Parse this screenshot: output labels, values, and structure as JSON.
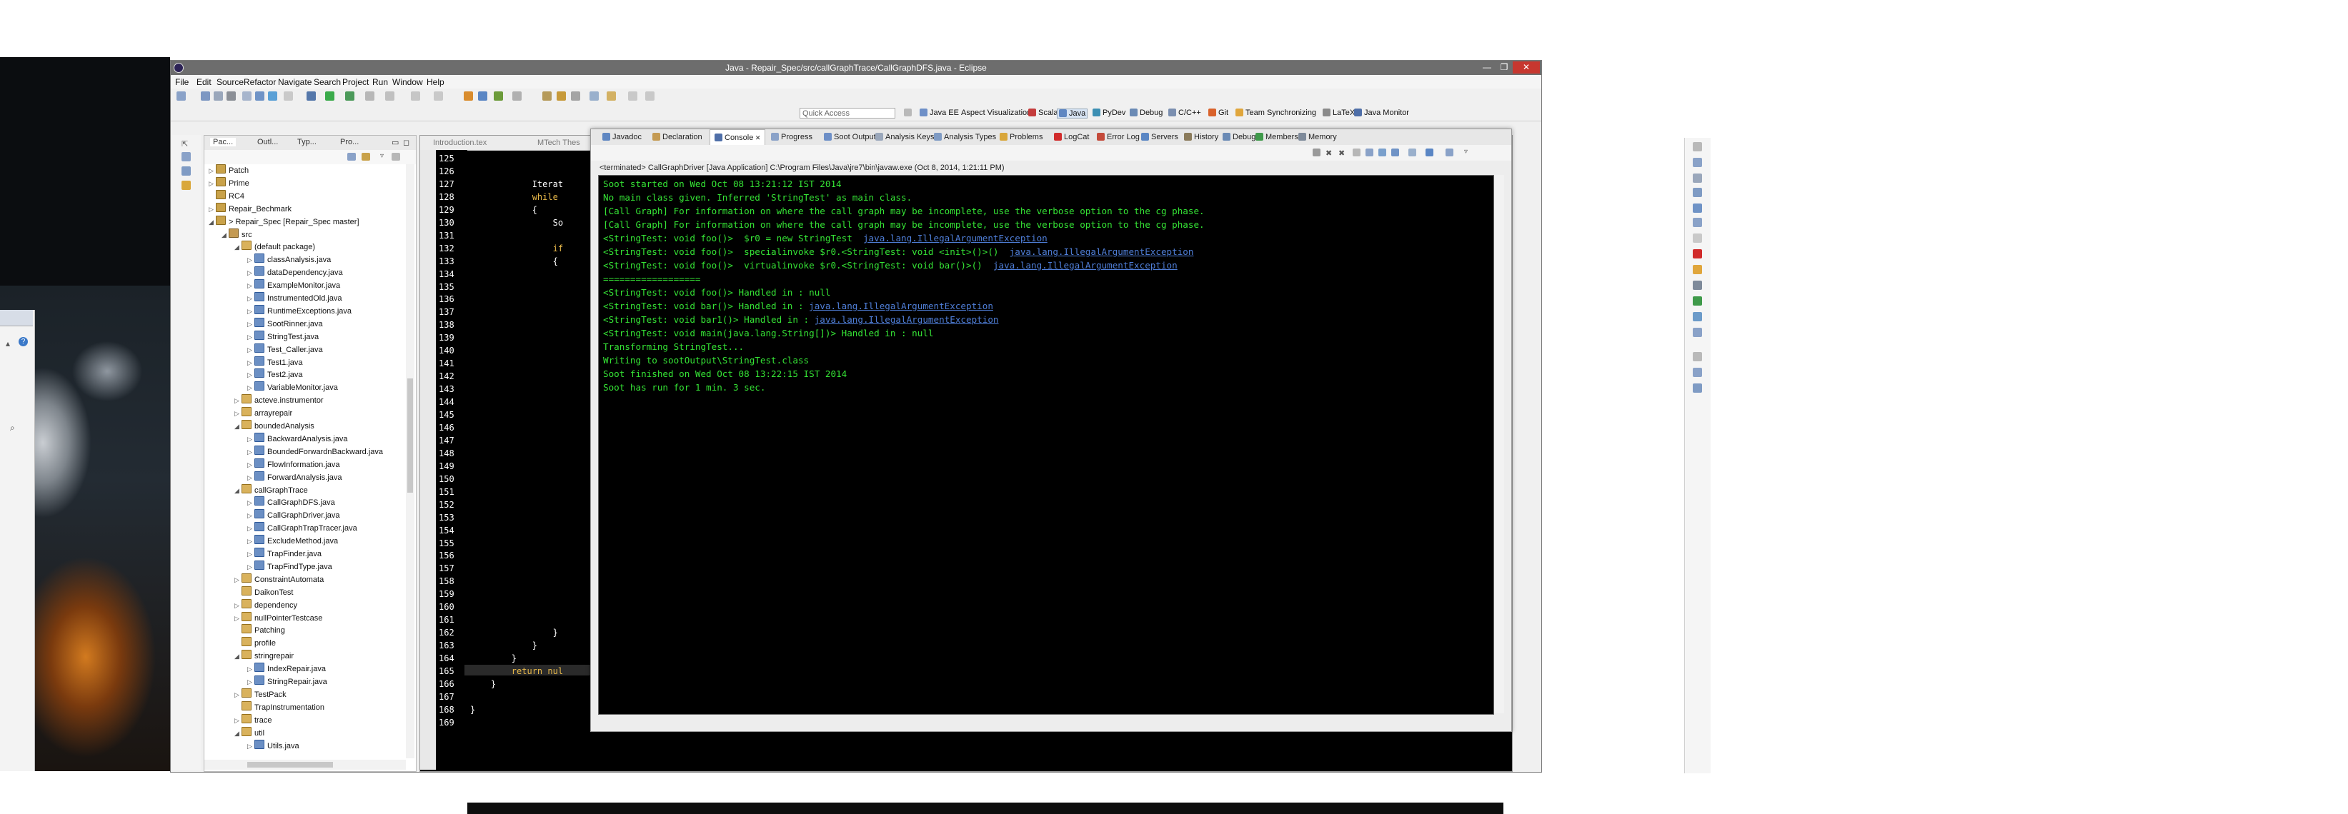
{
  "window": {
    "title": "Java - Repair_Spec/src/callGraphTrace/CallGraphDFS.java - Eclipse",
    "min": "—",
    "max": "❐",
    "close": "✕"
  },
  "menu": [
    "File",
    "Edit",
    "Source",
    "Refactor",
    "Navigate",
    "Search",
    "Project",
    "Run",
    "Window",
    "Help"
  ],
  "quick_access": {
    "placeholder": "Quick Access"
  },
  "perspectives": [
    "Java EE",
    "Aspect Visualization",
    "Scala",
    "Java",
    "PyDev",
    "Debug",
    "C/C++",
    "Git",
    "Team Synchronizing",
    "LaTeX",
    "Java Monitor"
  ],
  "package_explorer": {
    "tabs": [
      "Pac...",
      "Outl...",
      "Typ...",
      "Pro..."
    ],
    "tree": [
      {
        "label": "Patch",
        "depth": 0,
        "type": "proj",
        "tw": "▷"
      },
      {
        "label": "Prime",
        "depth": 0,
        "type": "proj",
        "tw": "▷"
      },
      {
        "label": "RC4",
        "depth": 0,
        "type": "proj",
        "tw": ""
      },
      {
        "label": "Repair_Bechmark",
        "depth": 0,
        "type": "proj",
        "tw": "▷"
      },
      {
        "label": "> Repair_Spec [Repair_Spec master]",
        "depth": 0,
        "type": "proj",
        "tw": "◢"
      },
      {
        "label": "src",
        "depth": 1,
        "type": "src",
        "tw": "◢"
      },
      {
        "label": "(default package)",
        "depth": 2,
        "type": "pkg",
        "tw": "◢"
      },
      {
        "label": "classAnalysis.java",
        "depth": 3,
        "type": "java",
        "tw": "▷"
      },
      {
        "label": "dataDependency.java",
        "depth": 3,
        "type": "java",
        "tw": "▷"
      },
      {
        "label": "ExampleMonitor.java",
        "depth": 3,
        "type": "java",
        "tw": "▷"
      },
      {
        "label": "InstrumentedOld.java",
        "depth": 3,
        "type": "java",
        "tw": "▷"
      },
      {
        "label": "RuntimeExceptions.java",
        "depth": 3,
        "type": "java",
        "tw": "▷"
      },
      {
        "label": "SootRinner.java",
        "depth": 3,
        "type": "java",
        "tw": "▷"
      },
      {
        "label": "StringTest.java",
        "depth": 3,
        "type": "java",
        "tw": "▷"
      },
      {
        "label": "Test_Caller.java",
        "depth": 3,
        "type": "java",
        "tw": "▷"
      },
      {
        "label": "Test1.java",
        "depth": 3,
        "type": "java",
        "tw": "▷"
      },
      {
        "label": "Test2.java",
        "depth": 3,
        "type": "java",
        "tw": "▷"
      },
      {
        "label": "VariableMonitor.java",
        "depth": 3,
        "type": "java",
        "tw": "▷"
      },
      {
        "label": "acteve.instrumentor",
        "depth": 2,
        "type": "pkg",
        "tw": "▷"
      },
      {
        "label": "arrayrepair",
        "depth": 2,
        "type": "pkg",
        "tw": "▷"
      },
      {
        "label": "boundedAnalysis",
        "depth": 2,
        "type": "pkg",
        "tw": "◢"
      },
      {
        "label": "BackwardAnalysis.java",
        "depth": 3,
        "type": "java",
        "tw": "▷"
      },
      {
        "label": "BoundedForwardnBackward.java",
        "depth": 3,
        "type": "java",
        "tw": "▷"
      },
      {
        "label": "FlowInformation.java",
        "depth": 3,
        "type": "java",
        "tw": "▷"
      },
      {
        "label": "ForwardAnalysis.java",
        "depth": 3,
        "type": "java",
        "tw": "▷"
      },
      {
        "label": "callGraphTrace",
        "depth": 2,
        "type": "pkg",
        "tw": "◢"
      },
      {
        "label": "CallGraphDFS.java",
        "depth": 3,
        "type": "java",
        "tw": "▷"
      },
      {
        "label": "CallGraphDriver.java",
        "depth": 3,
        "type": "java",
        "tw": "▷"
      },
      {
        "label": "CallGraphTrapTracer.java",
        "depth": 3,
        "type": "java",
        "tw": "▷"
      },
      {
        "label": "ExcludeMethod.java",
        "depth": 3,
        "type": "java",
        "tw": "▷"
      },
      {
        "label": "TrapFinder.java",
        "depth": 3,
        "type": "java",
        "tw": "▷"
      },
      {
        "label": "TrapFindType.java",
        "depth": 3,
        "type": "java",
        "tw": "▷"
      },
      {
        "label": "ConstraintAutomata",
        "depth": 2,
        "type": "pkg",
        "tw": "▷"
      },
      {
        "label": "DaikonTest",
        "depth": 2,
        "type": "pkg",
        "tw": ""
      },
      {
        "label": "dependency",
        "depth": 2,
        "type": "pkg",
        "tw": "▷"
      },
      {
        "label": "nullPointerTestcase",
        "depth": 2,
        "type": "pkg",
        "tw": "▷"
      },
      {
        "label": "Patching",
        "depth": 2,
        "type": "pkg",
        "tw": ""
      },
      {
        "label": "profile",
        "depth": 2,
        "type": "pkg",
        "tw": ""
      },
      {
        "label": "stringrepair",
        "depth": 2,
        "type": "pkg",
        "tw": "◢"
      },
      {
        "label": "IndexRepair.java",
        "depth": 3,
        "type": "java",
        "tw": "▷"
      },
      {
        "label": "StringRepair.java",
        "depth": 3,
        "type": "java",
        "tw": "▷"
      },
      {
        "label": "TestPack",
        "depth": 2,
        "type": "pkg",
        "tw": "▷"
      },
      {
        "label": "TrapInstrumentation",
        "depth": 2,
        "type": "pkg",
        "tw": ""
      },
      {
        "label": "trace",
        "depth": 2,
        "type": "pkg",
        "tw": "▷"
      },
      {
        "label": "util",
        "depth": 2,
        "type": "pkg",
        "tw": "◢"
      },
      {
        "label": "Utils.java",
        "depth": 3,
        "type": "java",
        "tw": "▷"
      }
    ]
  },
  "editor": {
    "tabs": [
      "Introduction.tex",
      "MTech Thes"
    ],
    "line_numbers": [
      "125",
      "126",
      "127",
      "128",
      "129",
      "130",
      "131",
      "132",
      "133",
      "134",
      "135",
      "136",
      "137",
      "138",
      "139",
      "140",
      "141",
      "142",
      "143",
      "144",
      "145",
      "146",
      "147",
      "148",
      "149",
      "150",
      "151",
      "152",
      "153",
      "154",
      "155",
      "156",
      "157",
      "158",
      "159",
      "160",
      "161",
      "162",
      "163",
      "164",
      "165",
      "166",
      "167",
      "168",
      "169"
    ],
    "code": [
      {
        "row": 2,
        "indent": "            ",
        "text": "Iterat",
        "color": "#ffffff"
      },
      {
        "row": 3,
        "indent": "            ",
        "text": "while",
        "color": "#e8b94a"
      },
      {
        "row": 4,
        "indent": "            ",
        "text": "{",
        "color": "#ffffff"
      },
      {
        "row": 5,
        "indent": "                ",
        "text": "So",
        "color": "#ffffff"
      },
      {
        "row": 7,
        "indent": "                ",
        "text": "if",
        "color": "#e8b94a"
      },
      {
        "row": 8,
        "indent": "                ",
        "text": "{",
        "color": "#ffffff"
      },
      {
        "row": 37,
        "indent": "                ",
        "text": "}",
        "color": "#ffffff"
      },
      {
        "row": 38,
        "indent": "            ",
        "text": "}",
        "color": "#ffffff"
      },
      {
        "row": 39,
        "indent": "        ",
        "text": "}",
        "color": "#ffffff"
      },
      {
        "row": 40,
        "indent": "        ",
        "text": "return nul",
        "color": "#e8b94a"
      },
      {
        "row": 41,
        "indent": "    ",
        "text": "}",
        "color": "#ffffff"
      },
      {
        "row": 43,
        "indent": "",
        "text": "}",
        "color": "#ffffff"
      }
    ]
  },
  "console": {
    "tabs": [
      "Javadoc",
      "Declaration",
      "Console",
      "Progress",
      "Soot Output",
      "Analysis Keys",
      "Analysis Types",
      "Problems",
      "LogCat",
      "Error Log",
      "Servers",
      "History",
      "Debug",
      "Members",
      "Memory"
    ],
    "status": "<terminated> CallGraphDriver [Java Application] C:\\Program Files\\Java\\jre7\\bin\\javaw.exe (Oct 8, 2014, 1:21:11 PM)",
    "lines": [
      {
        "text": "Soot started on Wed Oct 08 13:21:12 IST 2014"
      },
      {
        "text": "No main class given. Inferred 'StringTest' as main class."
      },
      {
        "text": "[Call Graph] For information on where the call graph may be incomplete, use the verbose option to the cg phase."
      },
      {
        "text": "[Call Graph] For information on where the call graph may be incomplete, use the verbose option to the cg phase."
      },
      {
        "text": "<StringTest: void foo()>  $r0 = new StringTest  ",
        "link": "java.lang.IllegalArgumentException"
      },
      {
        "text": "<StringTest: void foo()>  specialinvoke $r0.<StringTest: void <init>()>()  ",
        "link": "java.lang.IllegalArgumentException"
      },
      {
        "text": "<StringTest: void foo()>  virtualinvoke $r0.<StringTest: void bar()>()  ",
        "link": "java.lang.IllegalArgumentException"
      },
      {
        "text": "=================="
      },
      {
        "text": "<StringTest: void foo()> Handled in : null"
      },
      {
        "text": "<StringTest: void bar()> Handled in : ",
        "link": "java.lang.IllegalArgumentException"
      },
      {
        "text": "<StringTest: void bar1()> Handled in : ",
        "link": "java.lang.IllegalArgumentException"
      },
      {
        "text": "<StringTest: void main(java.lang.String[])> Handled in : null"
      },
      {
        "text": "Transforming StringTest..."
      },
      {
        "text": "Writing to sootOutput\\StringTest.class"
      },
      {
        "text": "Soot finished on Wed Oct 08 13:22:15 IST 2014"
      },
      {
        "text": "Soot has run for 1 min. 3 sec."
      }
    ]
  }
}
